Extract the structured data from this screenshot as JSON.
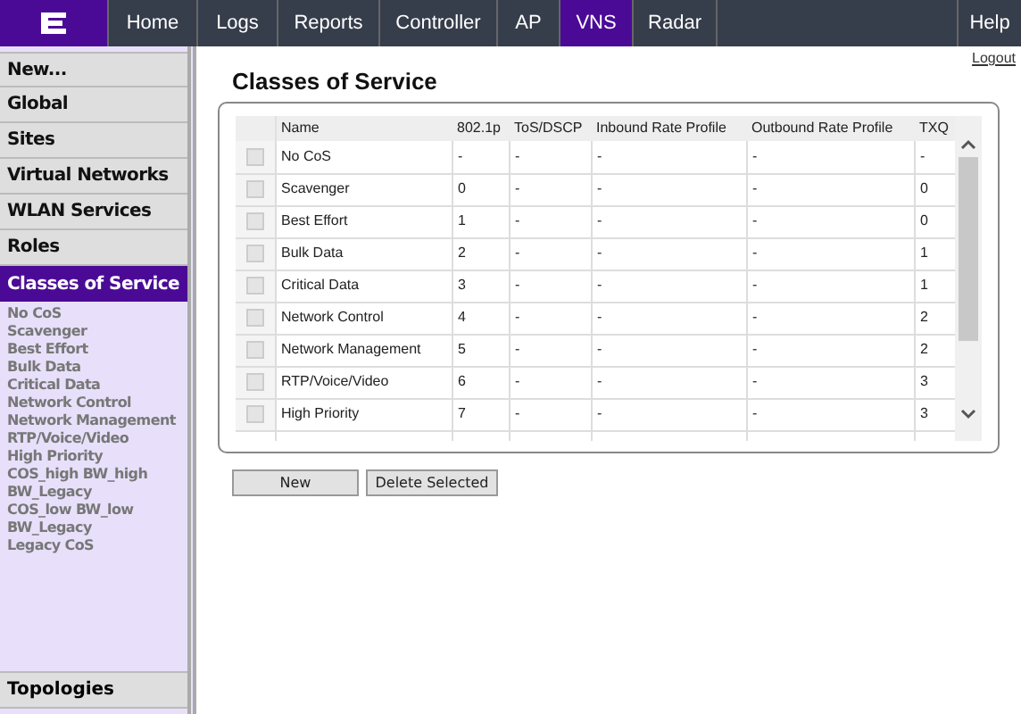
{
  "nav": {
    "tabs": [
      {
        "label": "Home",
        "selected": false
      },
      {
        "label": "Logs",
        "selected": false
      },
      {
        "label": "Reports",
        "selected": false
      },
      {
        "label": "Controller",
        "selected": false
      },
      {
        "label": "AP",
        "selected": false
      },
      {
        "label": "VNS",
        "selected": true
      },
      {
        "label": "Radar",
        "selected": false
      }
    ],
    "help": "Help"
  },
  "logout": "Logout",
  "sidebar": {
    "sections": [
      {
        "label": "New...",
        "selected": false
      },
      {
        "label": "Global",
        "selected": false
      },
      {
        "label": "Sites",
        "selected": false
      },
      {
        "label": "Virtual Networks",
        "selected": false
      },
      {
        "label": "WLAN Services",
        "selected": false
      },
      {
        "label": "Roles",
        "selected": false
      },
      {
        "label": "Classes of Service",
        "selected": true,
        "children": [
          "No CoS",
          "Scavenger",
          "Best Effort",
          "Bulk Data",
          "Critical Data",
          "Network Control",
          "Network Management",
          "RTP/Voice/Video",
          "High Priority",
          "COS_high BW_high",
          "BW_Legacy",
          "COS_low BW_low",
          "BW_Legacy",
          "Legacy CoS"
        ]
      }
    ],
    "footer": "Topologies"
  },
  "page": {
    "title": "Classes of Service"
  },
  "table": {
    "columns": [
      "Name",
      "802.1p",
      "ToS/DSCP",
      "Inbound Rate Profile",
      "Outbound Rate Profile",
      "TXQ"
    ],
    "rows": [
      {
        "checked": false,
        "cells": [
          "No CoS",
          "-",
          "-",
          "-",
          "-",
          "-"
        ]
      },
      {
        "checked": false,
        "cells": [
          "Scavenger",
          "0",
          "-",
          "-",
          "-",
          "0"
        ]
      },
      {
        "checked": false,
        "cells": [
          "Best Effort",
          "1",
          "-",
          "-",
          "-",
          "0"
        ]
      },
      {
        "checked": false,
        "cells": [
          "Bulk Data",
          "2",
          "-",
          "-",
          "-",
          "1"
        ]
      },
      {
        "checked": false,
        "cells": [
          "Critical Data",
          "3",
          "-",
          "-",
          "-",
          "1"
        ]
      },
      {
        "checked": false,
        "cells": [
          "Network Control",
          "4",
          "-",
          "-",
          "-",
          "2"
        ]
      },
      {
        "checked": false,
        "cells": [
          "Network Management",
          "5",
          "-",
          "-",
          "-",
          "2"
        ]
      },
      {
        "checked": false,
        "cells": [
          "RTP/Voice/Video",
          "6",
          "-",
          "-",
          "-",
          "3"
        ]
      },
      {
        "checked": false,
        "cells": [
          "High Priority",
          "7",
          "-",
          "-",
          "-",
          "3"
        ]
      }
    ]
  },
  "buttons": [
    "New",
    "Delete Selected"
  ]
}
